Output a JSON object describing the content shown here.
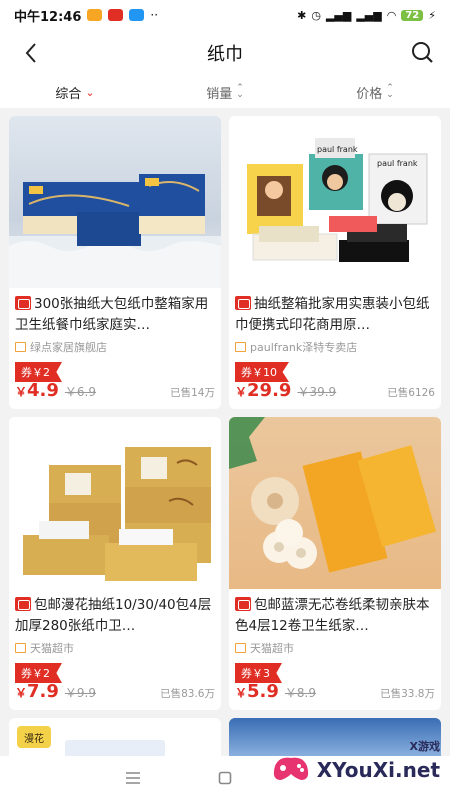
{
  "status_bar": {
    "time": "中午12:46",
    "battery": "72",
    "icons": [
      "app-icon-red",
      "app-icon-orange",
      "app-icon-blue",
      "more-dots",
      "bluetooth-icon",
      "alarm-icon",
      "signal-icon",
      "signal-icon",
      "wifi-icon",
      "battery-icon",
      "charging-icon"
    ]
  },
  "nav": {
    "title": "纸巾",
    "back_icon": "back-arrow-icon",
    "search_icon": "search-icon"
  },
  "sort": {
    "items": [
      {
        "label": "综合",
        "active": true
      },
      {
        "label": "销量",
        "active": false
      },
      {
        "label": "价格",
        "active": false
      }
    ]
  },
  "products": [
    {
      "title": "300张抽纸大包纸巾整箱家用卫生纸餐巾纸家庭实…",
      "shop": "绿点家居旗舰店",
      "coupon": "券￥2",
      "price_symbol": "￥",
      "price": "4.9",
      "orig_price": "￥6.9",
      "sold": "已售14万"
    },
    {
      "title": "抽纸整箱批家用实惠装小包纸巾便携式印花商用原…",
      "shop": "paulfrank泽特专卖店",
      "coupon": "券￥10",
      "price_symbol": "￥",
      "price": "29.9",
      "orig_price": "￥39.9",
      "sold": "已售6126"
    },
    {
      "title": "包邮漫花抽纸10/30/40包4层加厚280张纸巾卫…",
      "shop": "天猫超市",
      "coupon": "券￥2",
      "price_symbol": "￥",
      "price": "7.9",
      "orig_price": "￥9.9",
      "sold": "已售83.6万"
    },
    {
      "title": "包邮蓝漂无芯卷纸柔韧亲肤本色4层12卷卫生纸家…",
      "shop": "天猫超市",
      "coupon": "券￥3",
      "price_symbol": "￥",
      "price": "5.9",
      "orig_price": "￥8.9",
      "sold": "已售33.8万"
    }
  ],
  "image_text": {
    "paul_frank_1": "paul frank",
    "paul_frank_2": "paul frank",
    "peek_brand": "漫花"
  },
  "watermark": {
    "text": "XYouXi.net",
    "sub": "X游戏"
  },
  "colors": {
    "accent": "#e02e24",
    "background": "#f2f2f2"
  }
}
